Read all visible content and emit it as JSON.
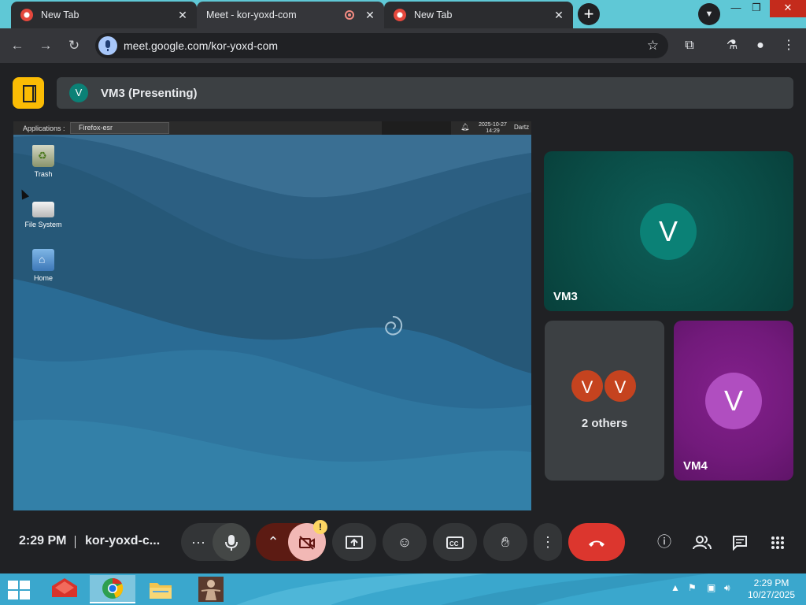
{
  "browser": {
    "tabs": [
      {
        "title": "New Tab",
        "active": false
      },
      {
        "title": "Meet - kor-yoxd-com",
        "active": true
      },
      {
        "title": "New Tab",
        "active": false
      }
    ],
    "url": "meet.google.com/kor-yoxd-com"
  },
  "meet": {
    "presenting_avatar": "V",
    "presenting_label": "VM3 (Presenting)",
    "shared_screen": {
      "panel": {
        "applications": "Applications :",
        "task": "Firefox-esr",
        "clock_date": "2025-10-27",
        "clock_time": "14:29",
        "user": "Dartz"
      },
      "desktop_icons": [
        {
          "label": "Trash",
          "icon": "trash-icon"
        },
        {
          "label": "File System",
          "icon": "drive-icon"
        },
        {
          "label": "Home",
          "icon": "home-folder-icon"
        }
      ]
    },
    "tiles": {
      "vm3": {
        "avatar": "V",
        "name": "VM3",
        "color": "#0b8176"
      },
      "others": {
        "avatars": [
          "V",
          "V"
        ],
        "caption": "2 others",
        "color": "#c5431f"
      },
      "vm4": {
        "avatar": "V",
        "name": "VM4",
        "color": "#b04ec0"
      }
    },
    "controls": {
      "time": "2:29 PM",
      "meeting_code": "kor-yoxd-c...",
      "camera_warning": "!",
      "icons": [
        "more-options-icon",
        "mic-icon",
        "chevron-up-icon",
        "camera-off-icon",
        "present-screen-icon",
        "emoji-icon",
        "captions-icon",
        "raise-hand-icon",
        "more-vert-icon",
        "end-call-icon",
        "info-icon",
        "people-icon",
        "chat-icon",
        "apps-grid-icon"
      ]
    }
  },
  "taskbar": {
    "time": "2:29 PM",
    "date": "10/27/2025"
  },
  "colors": {
    "accent_yellow": "#fbbc04",
    "end_call_red": "#dc362e",
    "tab_strip": "#5fc8d6",
    "taskbar": "#38a3c9"
  }
}
